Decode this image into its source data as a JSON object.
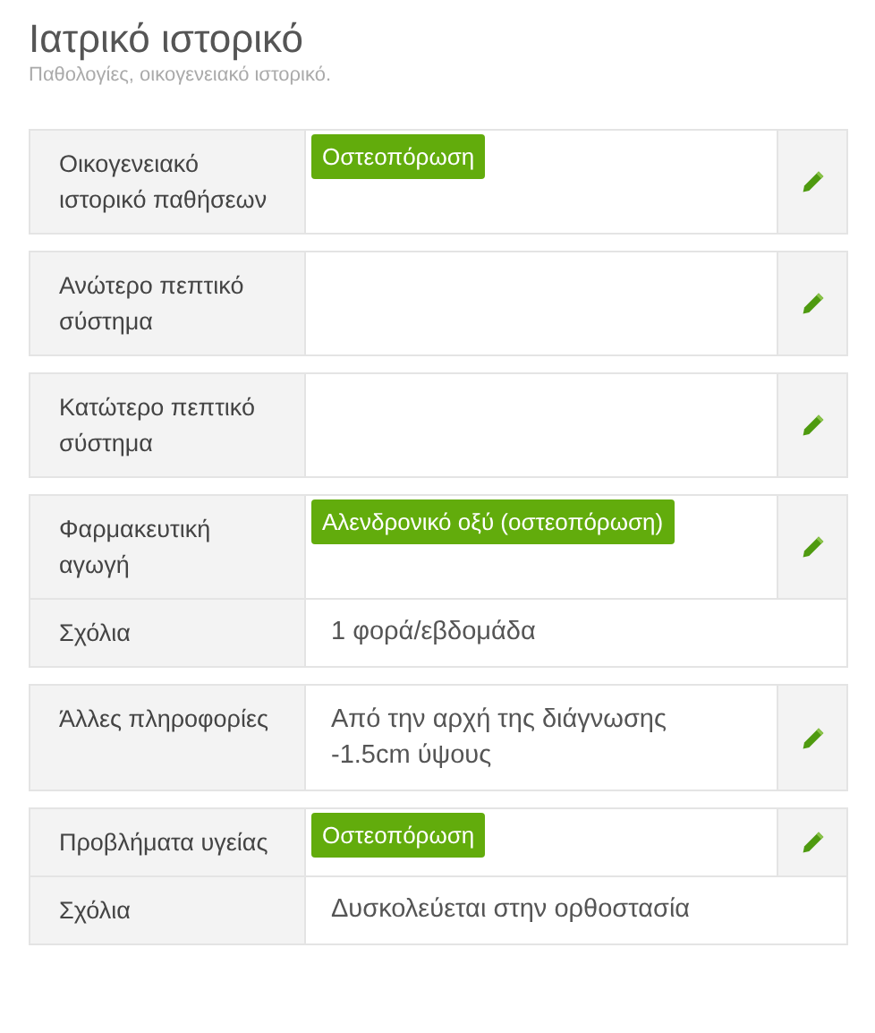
{
  "header": {
    "title": "Ιατρικό ιστορικό",
    "subtitle": "Παθολογίες, οικογενειακό ιστορικό."
  },
  "sections": [
    {
      "label": "Οικογενειακό ιστορικό παθήσεων",
      "kind": "tags",
      "tags": [
        "Οστεοπόρωση"
      ]
    },
    {
      "label": "Ανώτερο πεπτικό σύστημα",
      "kind": "empty"
    },
    {
      "label": "Κατώτερο πεπτικό σύστημα",
      "kind": "empty"
    },
    {
      "label": "Φαρμακευτική αγωγή",
      "kind": "tags",
      "tags": [
        "Αλενδρονικό οξύ (οστεοπόρωση)"
      ],
      "comment": {
        "label": "Σχόλια",
        "text": "1 φορά/εβδομάδα"
      }
    },
    {
      "label": "Άλλες πληροφορίες",
      "kind": "text",
      "text": "Από την αρχή της διάγνωσης -1.5cm ύψους"
    },
    {
      "label": "Προβλήματα υγείας",
      "kind": "tags",
      "tags": [
        "Οστεοπόρωση"
      ],
      "comment": {
        "label": "Σχόλια",
        "text": "Δυσκολεύεται στην ορθοστασία"
      }
    }
  ]
}
